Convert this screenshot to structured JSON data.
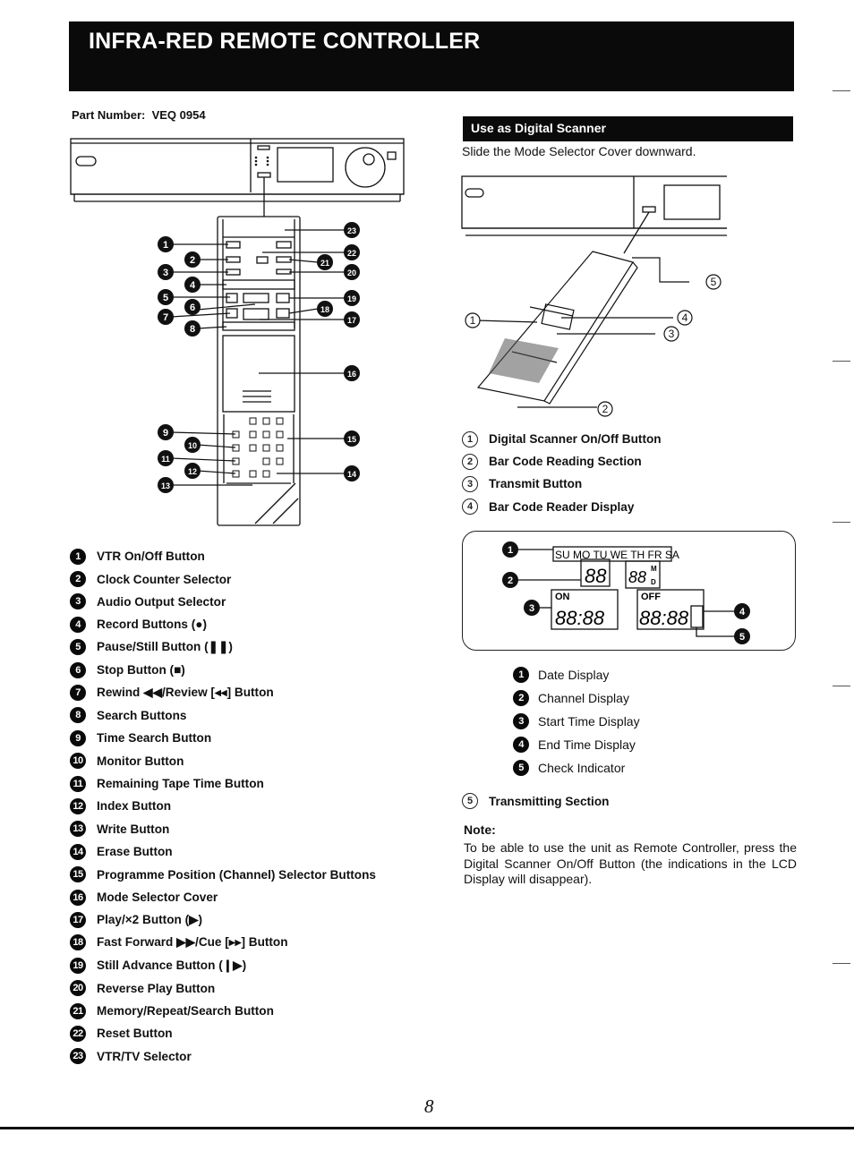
{
  "header": {
    "title": "INFRA-RED REMOTE CONTROLLER"
  },
  "part_number": {
    "label": "Part Number:",
    "value": "VEQ 0954"
  },
  "remote_diagram": {
    "callouts_left": [
      "1",
      "2",
      "3",
      "4",
      "5",
      "6",
      "7",
      "8",
      "9",
      "10",
      "11",
      "12",
      "13"
    ],
    "callouts_right": [
      "23",
      "22",
      "21",
      "20",
      "19",
      "18",
      "17",
      "16",
      "15",
      "14"
    ]
  },
  "remote_parts": [
    {
      "num": "1",
      "label": "VTR On/Off Button"
    },
    {
      "num": "2",
      "label": "Clock Counter Selector"
    },
    {
      "num": "3",
      "label": "Audio Output Selector"
    },
    {
      "num": "4",
      "label": "Record Buttons (●)"
    },
    {
      "num": "5",
      "label": "Pause/Still Button (❚❚)"
    },
    {
      "num": "6",
      "label": "Stop Button (■)"
    },
    {
      "num": "7",
      "label": "Rewind ◀◀/Review [◂◂] Button"
    },
    {
      "num": "8",
      "label": "Search Buttons"
    },
    {
      "num": "9",
      "label": "Time Search Button"
    },
    {
      "num": "10",
      "label": "Monitor Button"
    },
    {
      "num": "11",
      "label": "Remaining Tape Time Button"
    },
    {
      "num": "12",
      "label": "Index Button"
    },
    {
      "num": "13",
      "label": "Write Button"
    },
    {
      "num": "14",
      "label": "Erase Button"
    },
    {
      "num": "15",
      "label": "Programme Position (Channel) Selector Buttons"
    },
    {
      "num": "16",
      "label": "Mode Selector Cover"
    },
    {
      "num": "17",
      "label": "Play/×2 Button (▶)"
    },
    {
      "num": "18",
      "label": "Fast Forward ▶▶/Cue [▸▸] Button"
    },
    {
      "num": "19",
      "label": "Still Advance Button (❙▶)"
    },
    {
      "num": "20",
      "label": "Reverse Play Button"
    },
    {
      "num": "21",
      "label": "Memory/Repeat/Search Button"
    },
    {
      "num": "22",
      "label": "Reset Button"
    },
    {
      "num": "23",
      "label": "VTR/TV Selector"
    }
  ],
  "scanner": {
    "section_title": "Use as Digital Scanner",
    "intro": "Slide the Mode Selector Cover downward.",
    "diagram_callouts": [
      "1",
      "2",
      "3",
      "4",
      "5"
    ],
    "parts": [
      {
        "num": "1",
        "label": "Digital Scanner On/Off Button"
      },
      {
        "num": "2",
        "label": "Bar Code Reading Section"
      },
      {
        "num": "3",
        "label": "Transmit Button"
      },
      {
        "num": "4",
        "label": "Bar Code Reader Display"
      }
    ],
    "lcd": {
      "days": "SU MO TU WE TH FR SA",
      "channel_digits": "88",
      "date_digits": "88",
      "date_suffix_top": "M",
      "date_suffix_bottom": "D",
      "on_label": "ON",
      "on_time": "88:88",
      "off_label": "OFF",
      "off_time": "88:88",
      "callouts": [
        "1",
        "2",
        "3",
        "4",
        "5"
      ]
    },
    "lcd_parts": [
      {
        "num": "1",
        "label": "Date Display"
      },
      {
        "num": "2",
        "label": "Channel Display"
      },
      {
        "num": "3",
        "label": "Start Time Display"
      },
      {
        "num": "4",
        "label": "End Time Display"
      },
      {
        "num": "5",
        "label": "Check Indicator"
      }
    ],
    "transmitting": {
      "num": "5",
      "label": "Transmitting Section"
    },
    "note": {
      "heading": "Note:",
      "body": "To be able to use the unit as Remote Controller, press the Digital Scanner On/Off Button (the indications in the LCD Display will disappear)."
    }
  },
  "footer": {
    "page_number": "8"
  }
}
